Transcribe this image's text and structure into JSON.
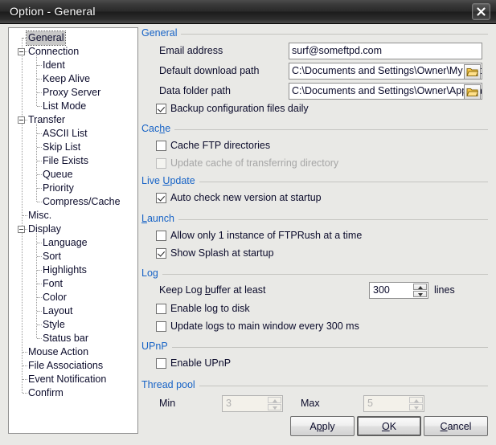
{
  "window": {
    "title": "Option - General",
    "close_icon": "close-icon"
  },
  "tree": {
    "items": [
      {
        "label": "General",
        "level": 0,
        "selected": true,
        "expandable": false
      },
      {
        "label": "Connection",
        "level": 0,
        "selected": false,
        "expandable": true
      },
      {
        "label": "Ident",
        "level": 1,
        "selected": false,
        "expandable": false
      },
      {
        "label": "Keep Alive",
        "level": 1,
        "selected": false,
        "expandable": false
      },
      {
        "label": "Proxy Server",
        "level": 1,
        "selected": false,
        "expandable": false
      },
      {
        "label": "List Mode",
        "level": 1,
        "selected": false,
        "expandable": false
      },
      {
        "label": "Transfer",
        "level": 0,
        "selected": false,
        "expandable": true
      },
      {
        "label": "ASCII List",
        "level": 1,
        "selected": false,
        "expandable": false
      },
      {
        "label": "Skip List",
        "level": 1,
        "selected": false,
        "expandable": false
      },
      {
        "label": "File Exists",
        "level": 1,
        "selected": false,
        "expandable": false
      },
      {
        "label": "Queue",
        "level": 1,
        "selected": false,
        "expandable": false
      },
      {
        "label": "Priority",
        "level": 1,
        "selected": false,
        "expandable": false
      },
      {
        "label": "Compress/Cache",
        "level": 1,
        "selected": false,
        "expandable": false
      },
      {
        "label": "Misc.",
        "level": 0,
        "selected": false,
        "expandable": false
      },
      {
        "label": "Display",
        "level": 0,
        "selected": false,
        "expandable": true
      },
      {
        "label": "Language",
        "level": 1,
        "selected": false,
        "expandable": false
      },
      {
        "label": "Sort",
        "level": 1,
        "selected": false,
        "expandable": false
      },
      {
        "label": "Highlights",
        "level": 1,
        "selected": false,
        "expandable": false
      },
      {
        "label": "Font",
        "level": 1,
        "selected": false,
        "expandable": false
      },
      {
        "label": "Color",
        "level": 1,
        "selected": false,
        "expandable": false
      },
      {
        "label": "Layout",
        "level": 1,
        "selected": false,
        "expandable": false
      },
      {
        "label": "Style",
        "level": 1,
        "selected": false,
        "expandable": false
      },
      {
        "label": "Status bar",
        "level": 1,
        "selected": false,
        "expandable": false
      },
      {
        "label": "Mouse Action",
        "level": 0,
        "selected": false,
        "expandable": false
      },
      {
        "label": "File Associations",
        "level": 0,
        "selected": false,
        "expandable": false
      },
      {
        "label": "Event Notification",
        "level": 0,
        "selected": false,
        "expandable": false
      },
      {
        "label": "Confirm",
        "level": 0,
        "selected": false,
        "expandable": false
      }
    ]
  },
  "groups": {
    "general": {
      "title": "General",
      "email_label": "Email address",
      "email_value": "surf@someftpd.com",
      "download_label": "Default download path",
      "download_value": "C:\\Documents and Settings\\Owner\\My Docu",
      "datafolder_label": "Data folder path",
      "datafolder_value": "C:\\Documents and Settings\\Owner\\Applicati",
      "backup_label": "Backup configuration files daily",
      "backup_checked": true
    },
    "cache": {
      "title": "Cache",
      "cache_ftp_label": "Cache FTP directories",
      "cache_ftp_checked": false,
      "update_cache_label": "Update cache of transferring directory",
      "update_cache_checked": false,
      "update_cache_disabled": true
    },
    "live_update": {
      "title": "Live Update",
      "auto_check_label": "Auto check new version at startup",
      "auto_check_checked": true
    },
    "launch": {
      "title": "Launch",
      "single_instance_label": "Allow only 1 instance of FTPRush at a time",
      "single_instance_checked": false,
      "splash_label": "Show Splash at startup",
      "splash_checked": true
    },
    "log": {
      "title": "Log",
      "buffer_label": "Keep Log buffer at least",
      "buffer_value": "300",
      "buffer_unit": "lines",
      "log_to_disk_label": "Enable log to disk",
      "log_to_disk_checked": false,
      "update_logs_label": "Update logs to main window every 300 ms",
      "update_logs_checked": false
    },
    "upnp": {
      "title": "UPnP",
      "enable_label": "Enable UPnP",
      "enable_checked": false
    },
    "thread_pool": {
      "title": "Thread pool",
      "min_label": "Min",
      "min_value": "3",
      "max_label": "Max",
      "max_value": "5",
      "disabled": true
    }
  },
  "footer": {
    "apply_label": "Apply",
    "ok_label": "OK",
    "cancel_label": "Cancel"
  },
  "colors": {
    "accent": "#1763c6",
    "dialog_bg": "#e9e9e6",
    "text": "#0b0b2b"
  }
}
